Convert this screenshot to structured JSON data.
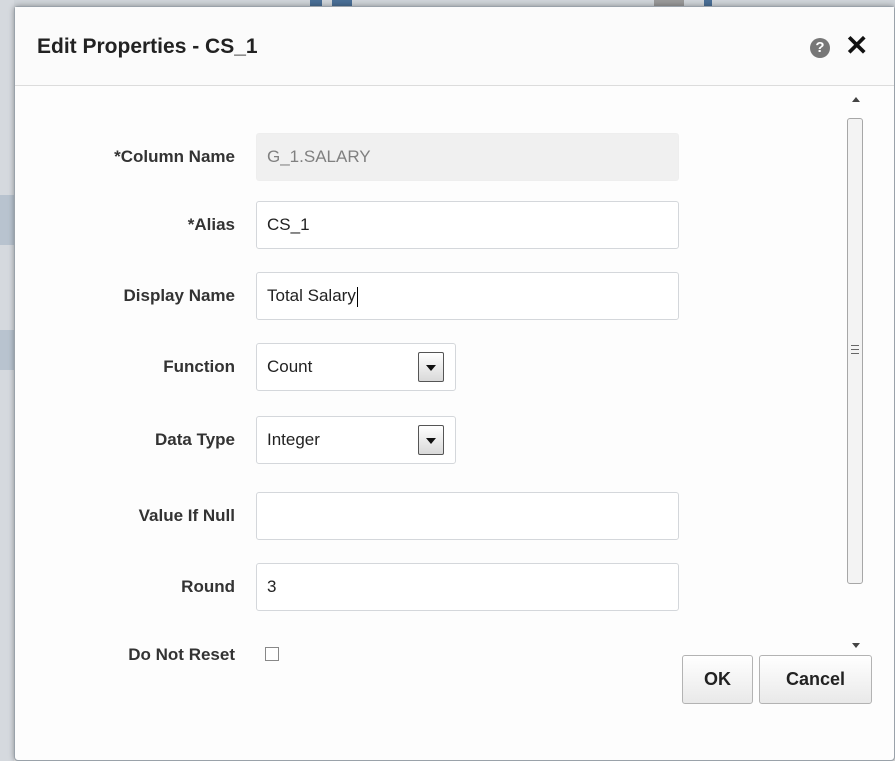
{
  "dialog": {
    "title": "Edit Properties - CS_1",
    "help_glyph": "?",
    "close_glyph": "✕"
  },
  "fields": {
    "column_name": {
      "label": "*Column Name",
      "value": "G_1.SALARY"
    },
    "alias": {
      "label": "*Alias",
      "value": "CS_1"
    },
    "display_name": {
      "label": "Display Name",
      "value": "Total Salary"
    },
    "function": {
      "label": "Function",
      "value": "Count"
    },
    "data_type": {
      "label": "Data Type",
      "value": "Integer"
    },
    "value_if_null": {
      "label": "Value If Null",
      "value": ""
    },
    "round": {
      "label": "Round",
      "value": "3"
    },
    "do_not_reset": {
      "label": "Do Not Reset",
      "checked": false
    }
  },
  "buttons": {
    "ok": "OK",
    "cancel": "Cancel"
  },
  "icons": {
    "help": "help-icon",
    "close": "close-icon",
    "dropdown": "chevron-down-icon"
  },
  "colors": {
    "dialog_bg": "#fdfdfd",
    "readonly_bg": "#f0f0f0",
    "label_text": "#333333"
  }
}
